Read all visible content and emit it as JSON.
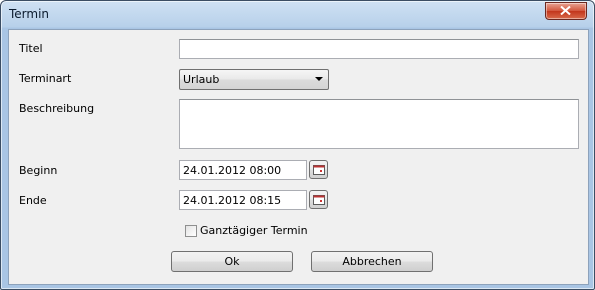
{
  "window": {
    "title": "Termin"
  },
  "form": {
    "titel_label": "Titel",
    "titel_value": "",
    "terminart_label": "Terminart",
    "terminart_value": "Urlaub",
    "beschreibung_label": "Beschreibung",
    "beschreibung_value": "",
    "beginn_label": "Beginn",
    "beginn_value": "24.01.2012 08:00",
    "ende_label": "Ende",
    "ende_value": "24.01.2012 08:15",
    "ganztaegig_label": "Ganztägiger Termin",
    "ganztaegig_checked": false
  },
  "buttons": {
    "ok": "Ok",
    "abbrechen": "Abbrechen"
  },
  "icons": {
    "close": "close-icon",
    "calendar": "calendar-icon",
    "dropdown": "chevron-down-icon"
  },
  "colors": {
    "title_bar": "#b7d0ea",
    "close_button": "#c2361c",
    "client_background": "#f0f0f0"
  }
}
